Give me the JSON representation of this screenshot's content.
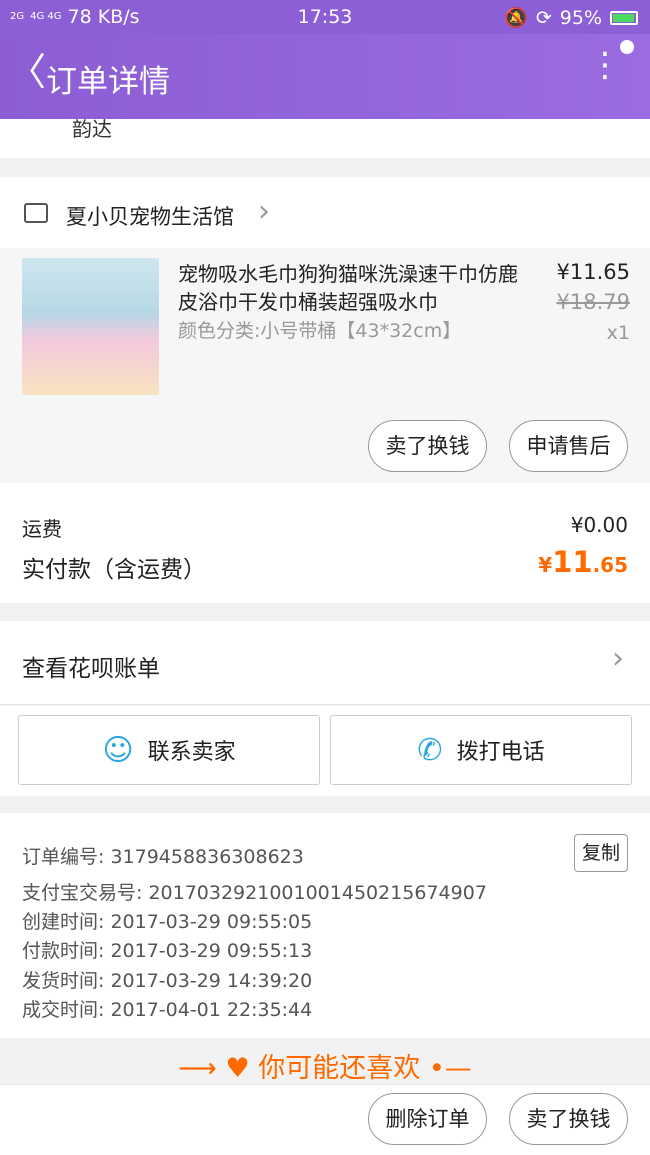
{
  "status_bar": {
    "signal_1": "2G",
    "signal_2": "4G 4G",
    "speed": "78 KB/s",
    "time": "17:53",
    "battery": "95%"
  },
  "header": {
    "title": "订单详情",
    "back_icon": "chevron-left-icon",
    "menu_icon": "more-vertical-icon"
  },
  "delivery": {
    "carrier": "韵达"
  },
  "store": {
    "name": "夏小贝宠物生活馆"
  },
  "product": {
    "name": "宠物吸水毛巾狗狗猫咪洗澡速干巾仿鹿皮浴巾干发巾桶装超强吸水巾",
    "sku": "颜色分类:小号带桶【43*32cm】",
    "price": "¥11.65",
    "original_price": "¥18.79",
    "quantity": "x1",
    "sell_button": "卖了换钱",
    "aftersale_button": "申请售后"
  },
  "summary": {
    "shipping_label": "运费",
    "shipping_value": "¥0.00",
    "paid_label": "实付款（含运费）",
    "paid_currency": "¥",
    "paid_int": "11",
    "paid_dec": ".65",
    "accent_color": "#ff6a00"
  },
  "huabei": {
    "label": "查看花呗账单"
  },
  "contact": {
    "seller_label": "联系卖家",
    "call_label": "拨打电话"
  },
  "order_info": {
    "order_no": "订单编号: 3179458836308623",
    "copy_label": "复制",
    "alipay_no": "支付宝交易号: 2017032921001001450215674907",
    "created": "创建时间: 2017-03-29 09:55:05",
    "paid": "付款时间: 2017-03-29 09:55:13",
    "shipped": "发货时间: 2017-03-29 14:39:20",
    "completed": "成交时间: 2017-04-01 22:35:44"
  },
  "recommend": {
    "label": "你可能还喜欢"
  },
  "bottom_bar": {
    "delete_button": "删除订单",
    "sell_button": "卖了换钱"
  }
}
